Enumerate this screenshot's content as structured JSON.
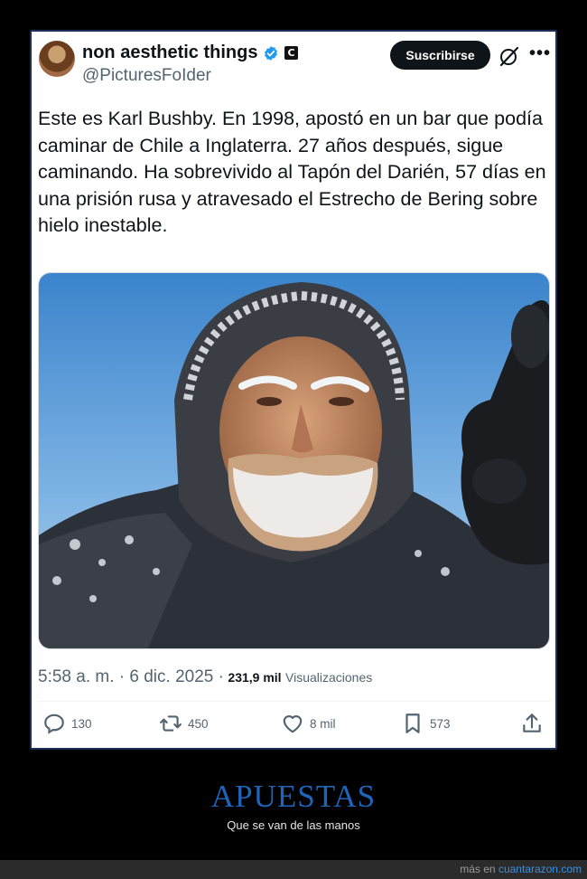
{
  "post": {
    "author_name": "non aesthetic things",
    "handle": "@PicturesFoIder",
    "affiliate_badge": "C",
    "subscribe_label": "Suscribirse",
    "more_label": "•••",
    "text": "Este es Karl Bushby. En 1998, apostó en un bar que podía caminar de Chile a Inglaterra. 27 años después, sigue caminando. Ha sobrevivido al Tapón del Darién, 57 días en una prisión rusa y atravesado el Estrecho de Bering sobre hielo inestable.",
    "time": "5:58 a. m. · 6 dic. 2025 ·",
    "views": "231,9 mil",
    "views_label": "Visualizaciones",
    "icons": {
      "verified": "verified-check-icon",
      "grok": "grok-icon",
      "reply": "reply-icon",
      "retweet": "retweet-icon",
      "like": "heart-icon",
      "bookmark": "bookmark-icon",
      "share": "share-icon"
    },
    "actions": {
      "replies": "130",
      "retweets": "450",
      "likes": "8 mil",
      "bookmarks": "573"
    }
  },
  "footer": {
    "title": "APUESTAS",
    "subtitle": "Que se van de las manos",
    "credit_prefix": "más en",
    "credit_link": "cuantarazon.com"
  },
  "colors": {
    "verified_blue": "#1d9bf0",
    "footer_title": "#1f64b8",
    "link": "#3a8fe0"
  }
}
